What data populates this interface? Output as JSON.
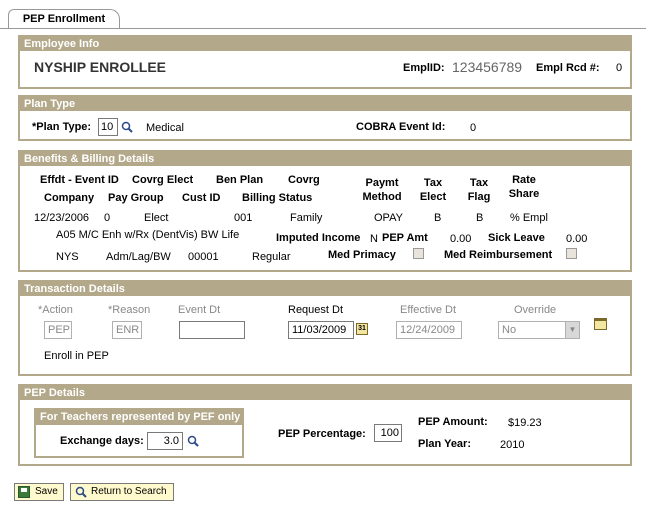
{
  "tab": {
    "label": "PEP Enrollment"
  },
  "employee_info": {
    "header": "Employee Info",
    "name": "NYSHIP ENROLLEE",
    "emplid_label": "EmplID:",
    "emplid": "123456789",
    "empl_rcd_label": "Empl Rcd #:",
    "empl_rcd": "0"
  },
  "plan_type": {
    "header": "Plan Type",
    "plan_type_label": "*Plan Type:",
    "plan_type_value": "10",
    "plan_type_desc": "Medical",
    "cobra_label": "COBRA Event Id:",
    "cobra_value": "0"
  },
  "benefits": {
    "header": "Benefits & Billing Details",
    "h_effdt": "Effdt - Event ID",
    "h_covrg_elect": "Covrg Elect",
    "h_ben_plan": "Ben Plan",
    "h_covrg": "Covrg",
    "h_paymt": "Paymt",
    "h_method": "Method",
    "h_tax1": "Tax",
    "h_elect": "Elect",
    "h_tax2": "Tax",
    "h_flag": "Flag",
    "h_rate": "Rate",
    "h_share": "Share",
    "h_company": "Company",
    "h_pay_group": "Pay Group",
    "h_cust_id": "Cust ID",
    "h_billing_status": "Billing Status",
    "effdt": "12/23/2006",
    "event_id": "0",
    "covrg_elect": "Elect",
    "ben_plan": "001",
    "covrg": "Family",
    "paymt_method": "OPAY",
    "tax_elect": "B",
    "tax_flag": "B",
    "rate_share": "% Empl",
    "plan_desc": "A05  M/C Enh w/Rx (DentVis) BW Life",
    "imputed_label": "Imputed Income",
    "imputed_value": "N",
    "pep_amt_label": "PEP Amt",
    "pep_amt_value": "0.00",
    "sick_leave_label": "Sick Leave",
    "sick_leave_value": "0.00",
    "company": "NYS",
    "pay_group": "Adm/Lag/BW",
    "cust_id": "00001",
    "billing_status": "Regular",
    "med_primacy_label": "Med Primacy",
    "med_reimb_label": "Med Reimbursement"
  },
  "transaction": {
    "header": "Transaction Details",
    "action_label": "*Action",
    "reason_label": "*Reason",
    "event_dt_label": "Event Dt",
    "request_dt_label": "Request Dt",
    "effective_dt_label": "Effective Dt",
    "override_label": "Override",
    "action_value": "PEP",
    "reason_value": "ENR",
    "event_dt_value": "",
    "request_dt_value": "11/03/2009",
    "effective_dt_value": "12/24/2009",
    "override_value": "No",
    "description": "Enroll in PEP",
    "calendar_text": "31"
  },
  "pep_details": {
    "header": "PEP Details",
    "teachers_header": "For Teachers represented by PEF only",
    "exchange_label": "Exchange days:",
    "exchange_value": "3.0",
    "pep_pct_label": "PEP Percentage:",
    "pep_pct_value": "100",
    "pep_amount_label": "PEP Amount:",
    "pep_amount_value": "$19.23",
    "plan_year_label": "Plan Year:",
    "plan_year_value": "2010"
  },
  "buttons": {
    "save": "Save",
    "return_to_search": "Return to Search"
  },
  "colors": {
    "section_header": "#b3a88a",
    "button_bg": "#fffacd",
    "disabled_text": "#888888"
  }
}
